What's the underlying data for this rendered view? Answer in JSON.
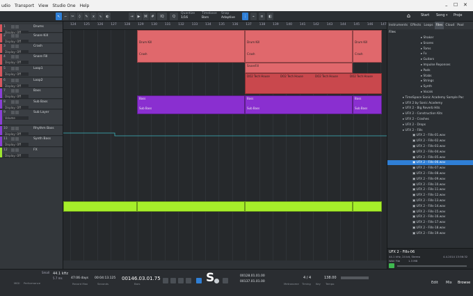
{
  "menu": [
    "udio",
    "Transport",
    "View",
    "Studio One",
    "Help"
  ],
  "toolbar": {
    "quantize_label": "Quantize",
    "quantize_value": "1/16",
    "timebase_label": "Timebase",
    "timebase_value": "Bars",
    "snap_label": "Snap",
    "snap_value": "Adaptive",
    "start": "Start",
    "song": "Song",
    "project": "Proje"
  },
  "tracks": [
    {
      "num": "1",
      "name": "Drums",
      "disp": "Display: Off",
      "color": "#d9565d"
    },
    {
      "num": "2",
      "name": "Snare Kill",
      "disp": "Display: Off",
      "color": "#d9565d"
    },
    {
      "num": "3",
      "name": "Crash",
      "disp": "Display: Off",
      "color": "#d9565d"
    },
    {
      "num": "4",
      "name": "Snare Fill",
      "disp": "Display: Off",
      "color": "#d9565d"
    },
    {
      "num": "5",
      "name": "Loop1",
      "disp": "Display: Off",
      "color": "#d9565d"
    },
    {
      "num": "6",
      "name": "Loop2",
      "disp": "Display: Off",
      "color": "#d9565d"
    },
    {
      "num": "7",
      "name": "Bass",
      "disp": "Display: Off",
      "color": "#8a3fd6"
    },
    {
      "num": "8",
      "name": "Sub Bass",
      "disp": "Display: Off",
      "color": "#8a3fd6"
    },
    {
      "num": "9",
      "name": "Sub Layer",
      "disp": "Volume",
      "color": "#8a3fd6"
    },
    {
      "num": "10",
      "name": "Rhythm Bass",
      "disp": "Display: Off",
      "color": "#8a3fd6"
    },
    {
      "num": "11",
      "name": "Synth Bass",
      "disp": "Display: Off",
      "color": "#8a3fd6"
    },
    {
      "num": "12",
      "name": "FX",
      "disp": "Display: Off",
      "color": "#9ee52f"
    }
  ],
  "ruler": [
    "124",
    "125",
    "126",
    "127",
    "128",
    "129",
    "130",
    "131",
    "132",
    "133",
    "134",
    "135",
    "136",
    "137",
    "138",
    "139",
    "140",
    "141",
    "142",
    "143",
    "144",
    "145",
    "146",
    "147"
  ],
  "clips": {
    "drum": "Drum Kill",
    "crash": "Crash",
    "snare": "SnareFill",
    "loop": "DO2 Tech House",
    "bass": "Bass",
    "sub": "Sub Bass"
  },
  "browser": {
    "tabs": [
      "Instruments",
      "Effects",
      "Loops",
      "Files",
      "Cloud",
      "Pool"
    ],
    "path": "Files",
    "items": [
      "Shaker",
      "Snares",
      "Toms",
      "Fx",
      "Guitars",
      "Impulse Reponses",
      "Pads",
      "Stabs",
      "Strings",
      "Synth",
      "Vocals",
      "TimeSpace Sonic Academy Sample Pac",
      "UFX 2 by Sonic Academy",
      "UFX 2 - Big Reverb Hits",
      "UFX 2 - Construction Kits",
      "UFX 2 - Crashes",
      "UFX 2 - Drops",
      "UFX 2 - Fills",
      "UFX 2 - Fills-01.wav",
      "UFX 2 - Fills-02.wav",
      "UFX 2 - Fills-03.wav",
      "UFX 2 - Fills-04.wav",
      "UFX 2 - Fills-05.wav",
      "UFX 2 - Fills-06.wav",
      "UFX 2 - Fills-07.wav",
      "UFX 2 - Fills-08.wav",
      "UFX 2 - Fills-09.wav",
      "UFX 2 - Fills-10.wav",
      "UFX 2 - Fills-11.wav",
      "UFX 2 - Fills-12.wav",
      "UFX 2 - Fills-13.wav",
      "UFX 2 - Fills-14.wav",
      "UFX 2 - Fills-15.wav",
      "UFX 2 - Fills-16.wav",
      "UFX 2 - Fills-17.wav",
      "UFX 2 - Fills-18.wav",
      "UFX 2 - Fills-19.wav"
    ],
    "selected_index": 23,
    "info_title": "UFX 2 - Fills-06",
    "info_line": "44.1 kHz, 24 bit, Stereo",
    "info_type": "WAV File",
    "info_size": "1.3 MB",
    "info_date": "4.4.2014 13:56:32"
  },
  "transport": {
    "rate": "44.1 kHz",
    "rate2": "5.7 ms",
    "perf": "Performance",
    "days": "47:06 days",
    "rec": "Record Max",
    "time": "00:04:13.125",
    "time_cap": "Seconds",
    "bars": "00146.03.01.75",
    "bars_cap": "Bars",
    "l": "00128.01.01.00",
    "r": "00137.01.01.00",
    "sig": "4 / 4",
    "sig_cap": "Timing",
    "key": "Key",
    "tempo": "138.00",
    "tempo_cap": "Tempo",
    "metro": "Metronome",
    "edit": "Edit",
    "mix": "Mix",
    "browse": "Browse",
    "small": "Small",
    "midi": "MIDI"
  },
  "colors": {
    "drum": "#e0686c",
    "loop": "#c9484d",
    "bass": "#8a2fd0",
    "fx": "#a6ef2a",
    "accent": "#2f7fd6"
  }
}
